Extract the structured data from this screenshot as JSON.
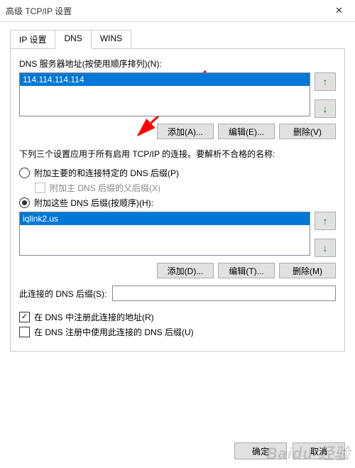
{
  "titlebar": {
    "title": "高级 TCP/IP 设置"
  },
  "tabs": {
    "ip": "IP 设置",
    "dns": "DNS",
    "wins": "WINS"
  },
  "dns_servers": {
    "label": "DNS 服务器地址(按使用顺序排列)(N):",
    "items": [
      "114.114.114.114"
    ],
    "add": "添加(A)...",
    "edit": "编辑(E)...",
    "remove": "删除(V)"
  },
  "suffix_section": {
    "intro": "下列三个设置应用于所有启用 TCP/IP 的连接。要解析不合格的名称:",
    "radio_primary": "附加主要的和连接特定的 DNS 后缀(P)",
    "sub_check": "附加主 DNS 后缀的父后缀(X)",
    "radio_these": "附加这些 DNS 后缀(按顺序)(H):",
    "items": [
      "iqlink2.us"
    ],
    "add": "添加(D)...",
    "edit": "编辑(T)...",
    "remove": "删除(M)"
  },
  "conn_suffix": {
    "label": "此连接的 DNS 后缀(S):",
    "value": ""
  },
  "register": {
    "reg_addr": "在 DNS 中注册此连接的地址(R)",
    "use_suffix": "在 DNS 注册中使用此连接的 DNS 后缀(U)"
  },
  "buttons": {
    "ok": "确定",
    "cancel": "取消"
  },
  "watermark": "Baidu 经验"
}
